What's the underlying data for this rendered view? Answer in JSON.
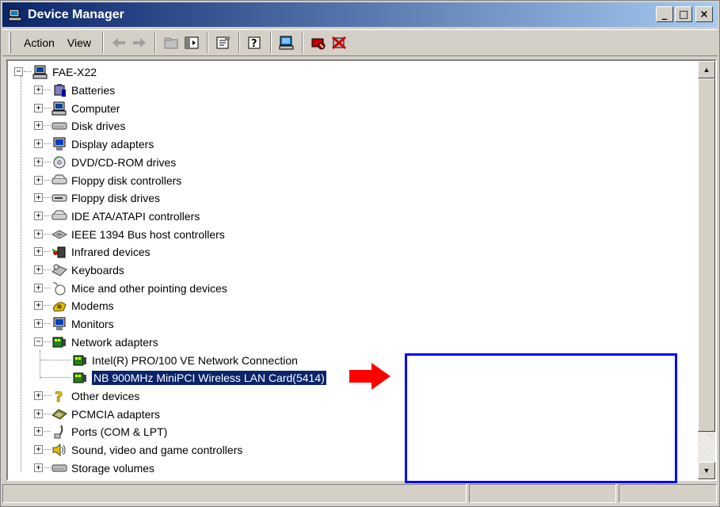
{
  "window": {
    "title": "Device Manager",
    "controls": {
      "minimize": "_",
      "maximize": "□",
      "close": "×"
    }
  },
  "menu": {
    "action": "Action",
    "view": "View"
  },
  "tree": {
    "root": "FAE-X22",
    "categories": [
      {
        "label": "Batteries",
        "icon": "battery-icon"
      },
      {
        "label": "Computer",
        "icon": "computer-icon"
      },
      {
        "label": "Disk drives",
        "icon": "disk-drive-icon"
      },
      {
        "label": "Display adapters",
        "icon": "display-adapter-icon"
      },
      {
        "label": "DVD/CD-ROM drives",
        "icon": "cdrom-icon"
      },
      {
        "label": "Floppy disk controllers",
        "icon": "controller-icon"
      },
      {
        "label": "Floppy disk drives",
        "icon": "floppy-drive-icon"
      },
      {
        "label": "IDE ATA/ATAPI controllers",
        "icon": "ide-controller-icon"
      },
      {
        "label": "IEEE 1394 Bus host controllers",
        "icon": "ieee1394-icon"
      },
      {
        "label": "Infrared devices",
        "icon": "infrared-icon"
      },
      {
        "label": "Keyboards",
        "icon": "keyboard-icon"
      },
      {
        "label": "Mice and other pointing devices",
        "icon": "mouse-icon"
      },
      {
        "label": "Modems",
        "icon": "modem-icon"
      },
      {
        "label": "Monitors",
        "icon": "monitor-icon"
      },
      {
        "label": "Network adapters",
        "icon": "network-adapter-icon",
        "expanded": true
      }
    ],
    "network_children": [
      {
        "label": "Intel(R) PRO/100 VE Network Connection"
      },
      {
        "label": "NB 900MHz MiniPCI Wireless LAN Card(5414)",
        "selected": true
      }
    ],
    "categories_after": [
      {
        "label": "Other devices",
        "icon": "question-icon"
      },
      {
        "label": "PCMCIA adapters",
        "icon": "pcmcia-icon"
      },
      {
        "label": "Ports (COM & LPT)",
        "icon": "port-icon"
      },
      {
        "label": "Sound, video and game controllers",
        "icon": "sound-icon"
      },
      {
        "label": "Storage volumes",
        "icon": "storage-volume-icon"
      }
    ]
  },
  "colors": {
    "selection": "#0a246a",
    "annotation_arrow": "#ff0000",
    "annotation_box": "#0000ff"
  }
}
